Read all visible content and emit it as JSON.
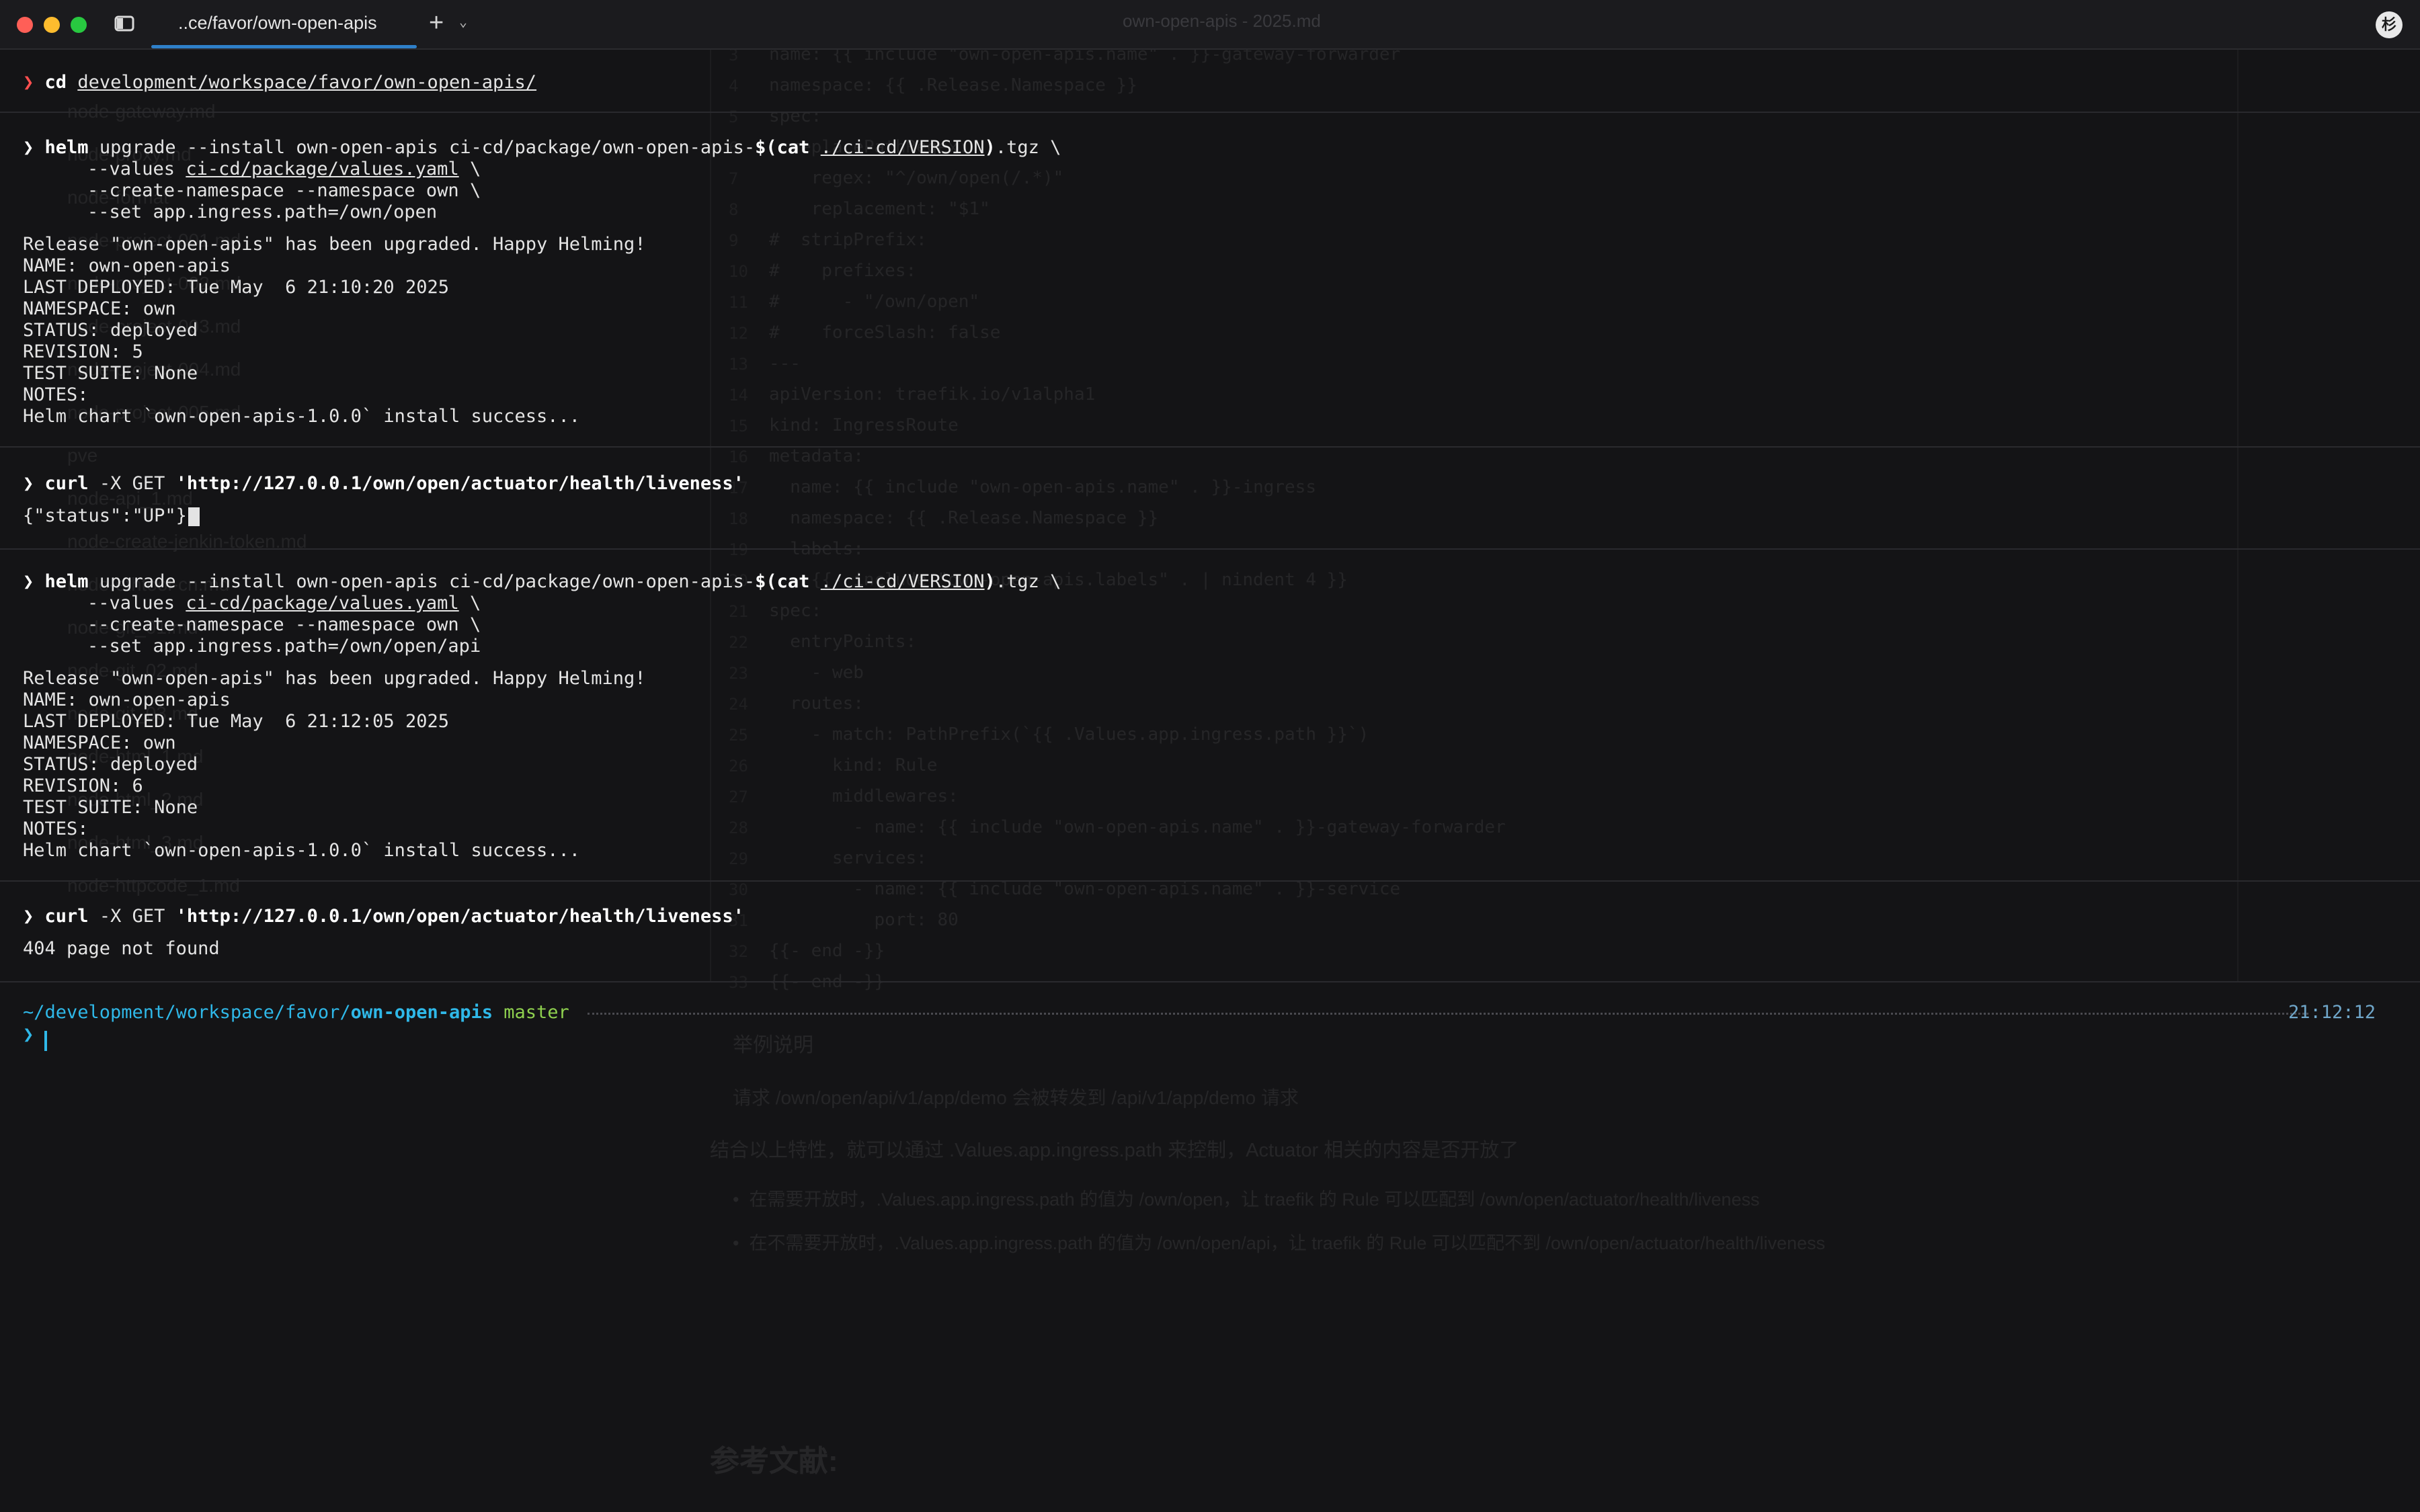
{
  "titlebar": {
    "tab_title": "..ce/favor/own-open-apis",
    "new_tab": "+",
    "tab_menu": "⌄",
    "window_title": "own-open-apis - 2025.md",
    "profile_letter": "杉"
  },
  "terminal": {
    "prompt_symbol": "❯",
    "b1": {
      "cmd": "cd",
      "path": "development/workspace/favor/own-open-apis/"
    },
    "b2": {
      "cmd": "helm",
      "rest": " upgrade --install own-open-apis ci-cd/package/own-open-apis-",
      "subst_open": "$(",
      "cat": "cat",
      "sub_path": "./ci-cd/VERSION",
      "subst_close": ")",
      "tail": ".tgz \\",
      "l2_prefix": "--values ",
      "l2_path": "ci-cd/package/values.yaml",
      "l2_tail": " \\",
      "l3": "--create-namespace --namespace own \\",
      "l4": "--set app.ingress.path=/own/open",
      "out": [
        "Release \"own-open-apis\" has been upgraded. Happy Helming!",
        "NAME: own-open-apis",
        "LAST DEPLOYED: Tue May  6 21:10:20 2025",
        "NAMESPACE: own",
        "STATUS: deployed",
        "REVISION: 5",
        "TEST SUITE: None",
        "NOTES:",
        "Helm chart `own-open-apis-1.0.0` install success..."
      ]
    },
    "b3": {
      "cmd": "curl",
      "rest": " -X GET ",
      "url": "'http://127.0.0.1/own/open/actuator/health/liveness'",
      "out": "{\"status\":\"UP\"}",
      "cursor_char": "%"
    },
    "b4": {
      "cmd": "helm",
      "rest": " upgrade --install own-open-apis ci-cd/package/own-open-apis-",
      "subst_open": "$(",
      "cat": "cat",
      "sub_path": "./ci-cd/VERSION",
      "subst_close": ")",
      "tail": ".tgz \\",
      "l2_prefix": "--values ",
      "l2_path": "ci-cd/package/values.yaml",
      "l2_tail": " \\",
      "l3": "--create-namespace --namespace own \\",
      "l4": "--set app.ingress.path=/own/open/api",
      "out": [
        "Release \"own-open-apis\" has been upgraded. Happy Helming!",
        "NAME: own-open-apis",
        "LAST DEPLOYED: Tue May  6 21:12:05 2025",
        "NAMESPACE: own",
        "STATUS: deployed",
        "REVISION: 6",
        "TEST SUITE: None",
        "NOTES:",
        "Helm chart `own-open-apis-1.0.0` install success..."
      ]
    },
    "b5": {
      "cmd": "curl",
      "rest": " -X GET ",
      "url": "'http://127.0.0.1/own/open/actuator/health/liveness'",
      "out": "404 page not found"
    },
    "status": {
      "path": "~/development/workspace/favor/",
      "repo": "own-open-apis",
      "branch": "master",
      "time": "21:12:12"
    }
  },
  "ghost": {
    "code": [
      "name: {{ include \"own-open-apis.name\" . }}-gateway-forwarder",
      "namespace: {{ .Release.Namespace }}",
      "spec:",
      "  replacePathRegex:",
      "    regex: \"^/own/open(/.*)\"",
      "    replacement: \"$1\"",
      "#  stripPrefix:",
      "#    prefixes:",
      "#      - \"/own/open\"",
      "#    forceSlash: false",
      "---",
      "apiVersion: traefik.io/v1alpha1",
      "kind: IngressRoute",
      "metadata:",
      "  name: {{ include \"own-open-apis.name\" . }}-ingress",
      "  namespace: {{ .Release.Namespace }}",
      "  labels:",
      "    {{- include \"own-open-apis.labels\" . | nindent 4 }}",
      "spec:",
      "  entryPoints:",
      "    - web",
      "  routes:",
      "    - match: PathPrefix(`{{ .Values.app.ingress.path }}`)",
      "      kind: Rule",
      "      middlewares:",
      "        - name: {{ include \"own-open-apis.name\" . }}-gateway-forwarder",
      "      services:",
      "        - name: {{ include \"own-open-apis.name\" . }}-service",
      "          port: 80",
      "{{- end -}}",
      "{{- end -}}"
    ],
    "sidebar": [
      "node-gateway.md",
      "node-proxy.md",
      "node-format",
      "node-project-001.md",
      "node-project-002.md",
      "node-project-003.md",
      "node-project-004.md",
      "node-project-005.md",
      "pve",
      "node-api_1.md",
      "node-create-jenkin-token.md",
      "node-ethtool-cn.md",
      "node-git_01.md",
      "node-git_02.md",
      "node-git_03.md",
      "node-html_1.md",
      "node-html_2.md",
      "node-html_3.md",
      "node-httpcode_1.md"
    ],
    "doc": [
      "举例说明",
      "请求 /own/open/api/v1/app/demo 会被转发到 /api/v1/app/demo 请求",
      "结合以上特性，就可以通过 .Values.app.ingress.path 来控制，Actuator 相关的内容是否开放了",
      "•  在需要开放时，.Values.app.ingress.path 的值为 /own/open，让 traefik 的 Rule 可以匹配到 /own/open/actuator/health/liveness",
      "•  在不需要开放时，.Values.app.ingress.path 的值为 /own/open/api，让 traefik 的 Rule 可以匹配不到 /own/open/actuator/health/liveness",
      "参考文献:"
    ]
  }
}
